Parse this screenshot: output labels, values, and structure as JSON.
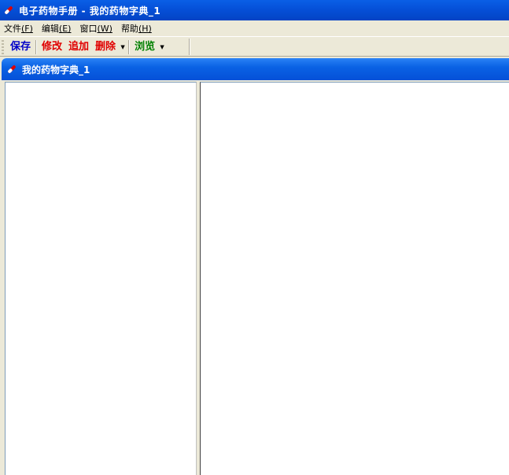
{
  "window": {
    "title": "电子药物手册 - 我的药物字典_1"
  },
  "menubar": {
    "items": [
      {
        "label": "文件",
        "accel": "(F)"
      },
      {
        "label": "编辑",
        "accel": "(E)"
      },
      {
        "label": "窗口",
        "accel": "(W)"
      },
      {
        "label": "帮助",
        "accel": "(H)"
      }
    ]
  },
  "toolbar": {
    "save_label": "保存",
    "modify_label": "修改",
    "append_label": "追加",
    "delete_label": "删除",
    "browse_label": "浏览",
    "colors": {
      "save": "#0000c8",
      "edit": "#e00000",
      "browse": "#008000"
    }
  },
  "child_window": {
    "title": "我的药物字典_1"
  },
  "icons": {
    "app": "pill-icon",
    "dropdown": "dropdown-arrow-icon"
  }
}
